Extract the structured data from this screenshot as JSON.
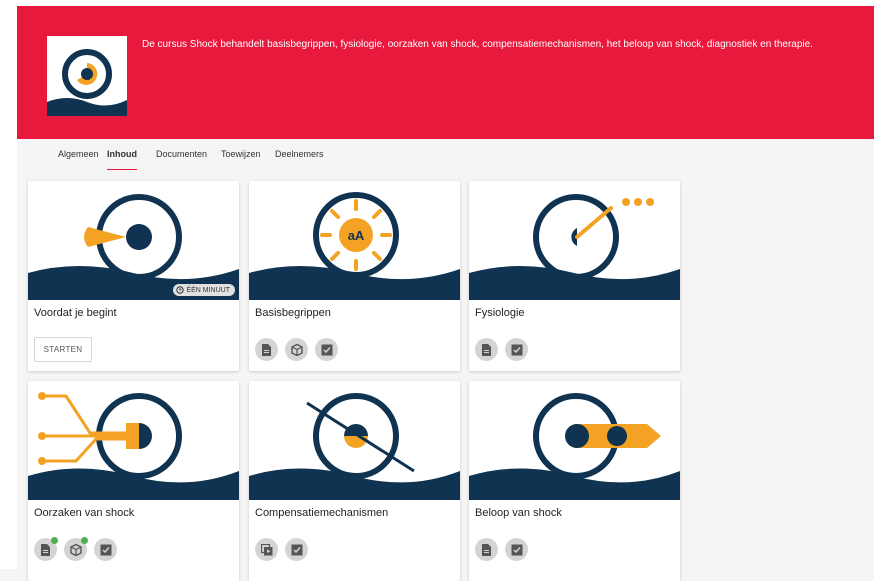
{
  "course": {
    "description": "De cursus Shock behandelt basisbegrippen, fysiologie, oorzaken van shock, compensatiemechanismen, het beloop van shock, diagnostiek en therapie.",
    "logo_icon": "shock-course-logo"
  },
  "tabs": [
    {
      "label": "Algemeen",
      "active": false
    },
    {
      "label": "Inhoud",
      "active": true
    },
    {
      "label": "Documenten",
      "active": false
    },
    {
      "label": "Toewijzen",
      "active": false
    },
    {
      "label": "Deelnemers",
      "active": false
    }
  ],
  "modules": [
    {
      "title": "Voordat je begint",
      "badge": "ÉÉN MINUUT",
      "button": "STARTEN",
      "icons": []
    },
    {
      "title": "Basisbegrippen",
      "icons": [
        {
          "name": "document-icon",
          "done": false
        },
        {
          "name": "cube-icon",
          "done": false
        },
        {
          "name": "checklist-icon",
          "done": false
        }
      ]
    },
    {
      "title": "Fysiologie",
      "icons": [
        {
          "name": "document-icon",
          "done": false
        },
        {
          "name": "checklist-icon",
          "done": false
        }
      ]
    },
    {
      "title": "Oorzaken van shock",
      "icons": [
        {
          "name": "document-icon",
          "done": true
        },
        {
          "name": "cube-icon",
          "done": true
        },
        {
          "name": "checklist-icon",
          "done": false
        }
      ]
    },
    {
      "title": "Compensatiemechanismen",
      "icons": [
        {
          "name": "media-icon",
          "done": false
        },
        {
          "name": "checklist-icon",
          "done": false
        }
      ]
    },
    {
      "title": "Beloop van shock",
      "icons": [
        {
          "name": "document-icon",
          "done": false
        },
        {
          "name": "checklist-icon",
          "done": false
        }
      ]
    }
  ],
  "colors": {
    "header": "#e8193c",
    "navy": "#0f3350",
    "orange": "#f4a223",
    "check": "#4caf50"
  }
}
